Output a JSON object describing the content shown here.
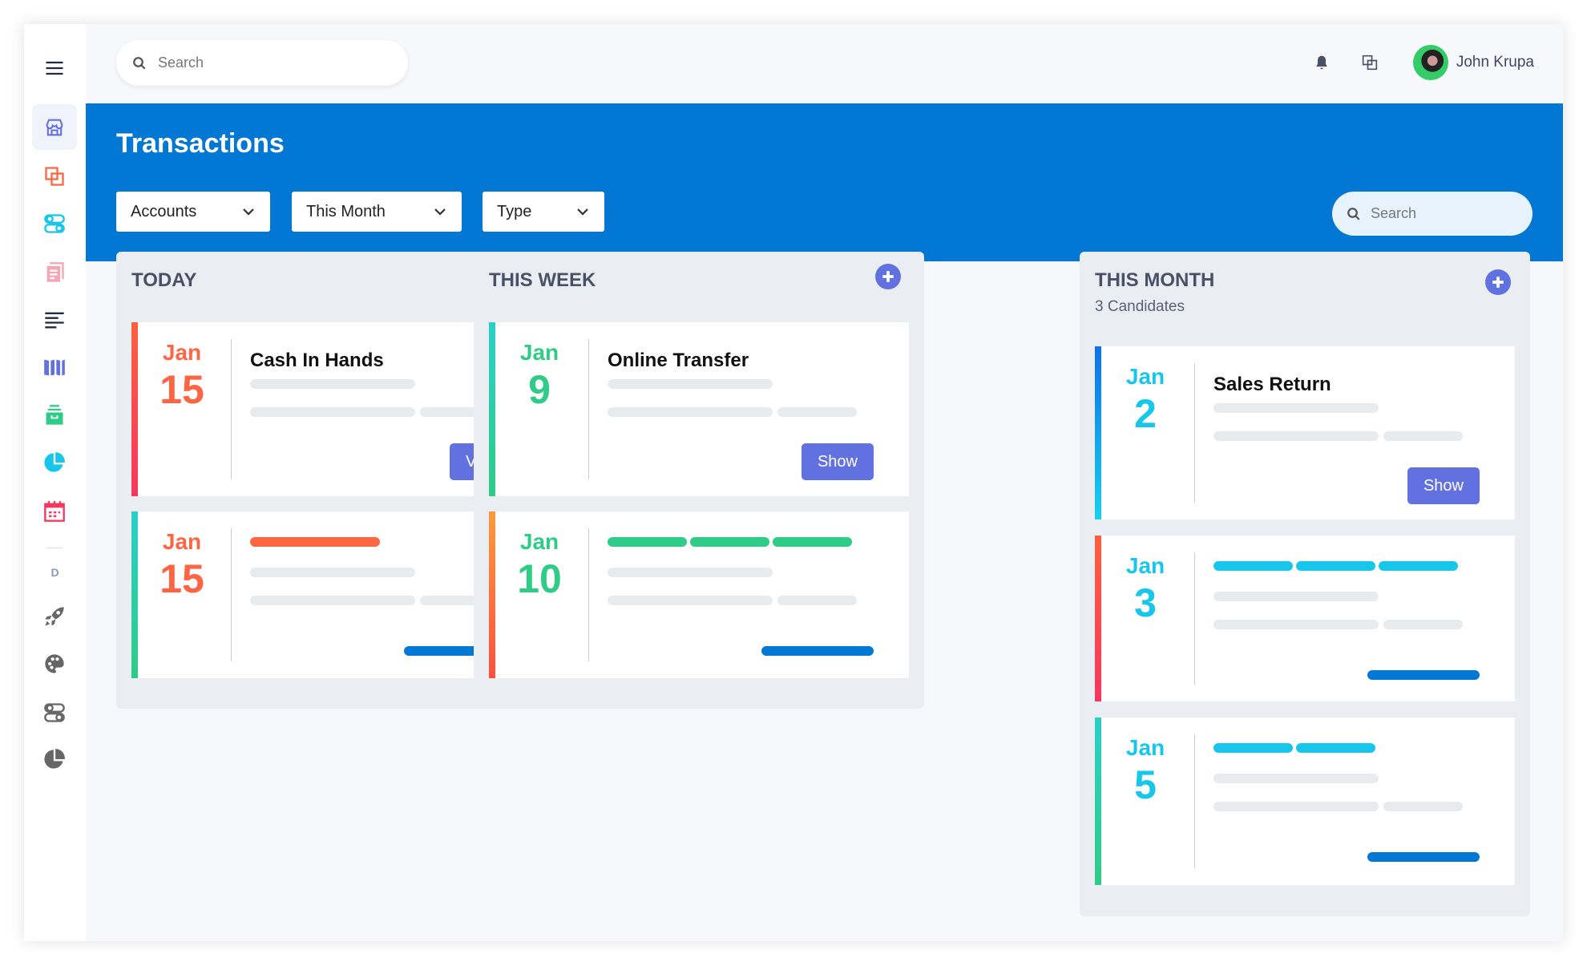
{
  "header": {
    "search_placeholder": "Search",
    "user_name": "John Krupa"
  },
  "page": {
    "title": "Transactions",
    "search_placeholder": "Search"
  },
  "filters": [
    {
      "label": "Accounts"
    },
    {
      "label": "This Month"
    },
    {
      "label": "Type"
    }
  ],
  "sidebar": {
    "section_label": "D"
  },
  "colors": {
    "brand_blue": "#0277d4",
    "button": "#6271e0",
    "orange": "#fd6543",
    "green": "#2ecc87",
    "cyan": "#17c7eb"
  },
  "columns": [
    {
      "title": "TODAY",
      "subtitle": "",
      "cards": [
        {
          "month": "Jan",
          "day": "15",
          "date_color": "#fd6543",
          "accent": [
            "#fd6040",
            "#f8365f"
          ],
          "title": "Cash In Hands",
          "button": "View"
        },
        {
          "month": "Jan",
          "day": "15",
          "date_color": "#fd6543",
          "accent": [
            "#2ad0c8",
            "#2ecc87"
          ],
          "tag_color": "#fd6543",
          "tag_segments": 1
        }
      ]
    },
    {
      "title": "THIS WEEK",
      "subtitle": "",
      "cards": [
        {
          "month": "Jan",
          "day": "9",
          "date_color": "#2ecc87",
          "accent": [
            "#2ad0c8",
            "#2ecc87"
          ],
          "title": "Online Transfer",
          "button": "Show"
        },
        {
          "month": "Jan",
          "day": "10",
          "date_color": "#2ecc87",
          "accent": [
            "#fb9a3c",
            "#fb5040"
          ],
          "tag_color": "#2ecc87",
          "tag_segments": 3
        }
      ]
    },
    {
      "title": "THIS MONTH",
      "subtitle": "3 Candidates",
      "cards": [
        {
          "month": "Jan",
          "day": "2",
          "date_color": "#17c7eb",
          "accent": [
            "#1071e6",
            "#17d0ee"
          ],
          "title": "Sales Return",
          "button": "Show"
        },
        {
          "month": "Jan",
          "day": "3",
          "date_color": "#17c7eb",
          "accent": [
            "#fd6040",
            "#f8365f"
          ],
          "tag_color": "#17c7eb",
          "tag_segments": 3
        },
        {
          "month": "Jan",
          "day": "5",
          "date_color": "#17c7eb",
          "accent": [
            "#2ad0c8",
            "#2ecc87"
          ],
          "tag_color": "#17c7eb",
          "tag_segments": 2
        }
      ]
    }
  ]
}
